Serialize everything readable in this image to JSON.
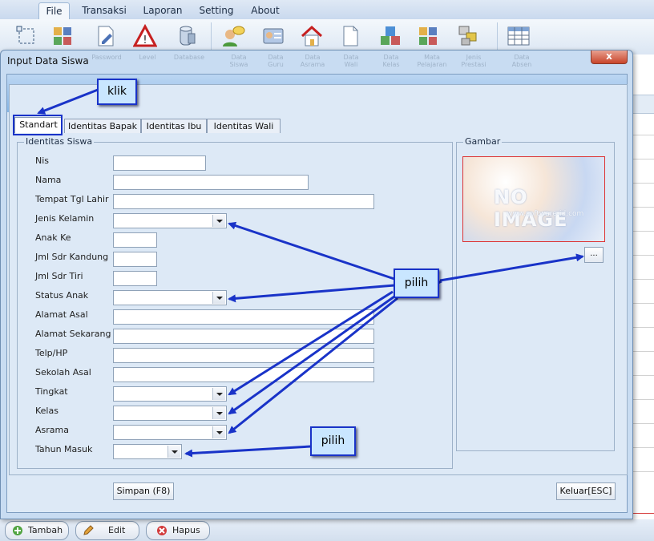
{
  "ribbon": {
    "tabs": [
      "File",
      "Transaksi",
      "Laporan",
      "Setting",
      "About"
    ],
    "active_tab": "File"
  },
  "dialog": {
    "title": "Input Data Siswa",
    "close_label": "x",
    "ghost_labels": [
      "Password",
      "Level",
      "Database",
      "Data Siswa",
      "Data Guru",
      "Data Asrama",
      "Data Wali",
      "Data Kelas",
      "Mata Pelajaran",
      "Jenis Prestasi",
      "Data Absen"
    ],
    "tabs": [
      "Standart",
      "Identitas Bapak",
      "Identitas Ibu",
      "Identitas Wali"
    ],
    "active_tab": "Standart",
    "group_identitas": "Identitas Siswa",
    "group_gambar": "Gambar",
    "fields": {
      "nis": "Nis",
      "nama": "Nama",
      "tempat_tgl_lahir": "Tempat Tgl Lahir",
      "jenis_kelamin": "Jenis Kelamin",
      "anak_ke": "Anak Ke",
      "jml_sdr_kandung": "Jml Sdr Kandung",
      "jml_sdr_tiri": "Jml Sdr Tiri",
      "status_anak": "Status Anak",
      "alamat_asal": "Alamat Asal",
      "alamat_sekarang": "Alamat Sekarang",
      "telp_hp": "Telp/HP",
      "sekolah_asal": "Sekolah Asal",
      "tingkat": "Tingkat",
      "kelas": "Kelas",
      "asrama": "Asrama",
      "tahun_masuk": "Tahun Masuk"
    },
    "no_image_text": "NO IMAGE",
    "no_image_url": "www.software-id.com",
    "browse_label": "...",
    "save_label": "Simpan (F8)",
    "exit_label": "Keluar[ESC]"
  },
  "annotations": {
    "klik": "klik",
    "pilih_1": "pilih",
    "pilih_2": "pilih"
  },
  "bottom": {
    "tambah": "Tambah",
    "edit": "Edit",
    "hapus": "Hapus"
  },
  "colors": {
    "annotation_blue": "#1933c8",
    "callout_fill": "#c9e6ff"
  }
}
